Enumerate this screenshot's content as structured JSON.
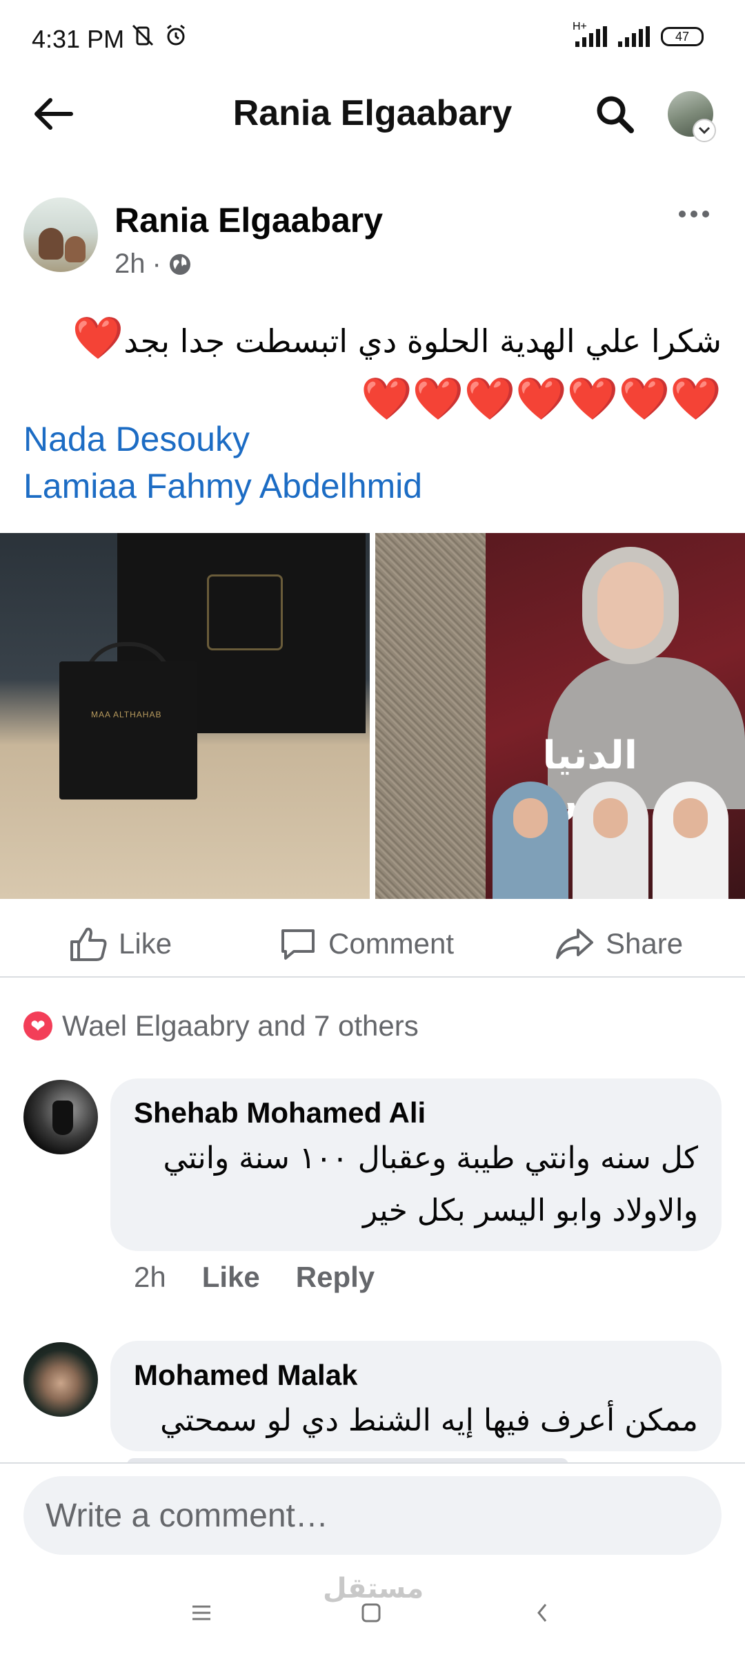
{
  "status_bar": {
    "time": "4:31 PM",
    "network": "H+",
    "battery": "47",
    "icons": [
      "mute-vibrate-icon",
      "alarm-icon",
      "signal-icon",
      "signal-icon",
      "battery-icon"
    ]
  },
  "header": {
    "title": "Rania Elgaabary",
    "icons": [
      "back-arrow-icon",
      "search-icon",
      "profile-avatar",
      "chevron-down-icon"
    ]
  },
  "post": {
    "author": "Rania Elgaabary",
    "time": "2h",
    "separator": "·",
    "privacy_icon": "globe-icon",
    "text_line1": "شكرا علي الهدية الحلوة دي اتبسطت جدا بجد",
    "hearts_line1": "❤️",
    "hearts_line2": "❤️❤️❤️❤️❤️❤️❤️",
    "tags": [
      "Nada Desouky",
      "Lamiaa Fahmy Abdelhmid"
    ],
    "photos": [
      {
        "alt": "gift bags on a desk",
        "bag_brand": "MAA ALTHAHAB"
      },
      {
        "alt": "women in front of TV banner",
        "banner_text": "الدنيا بخير"
      }
    ]
  },
  "actions": {
    "like": "Like",
    "comment": "Comment",
    "share": "Share"
  },
  "reactions": {
    "summary": "Wael Elgaabry and 7 others",
    "icon": "love-reaction-icon"
  },
  "comments": [
    {
      "author": "Shehab Mohamed Ali",
      "text_line1": "كل سنه وانتي طيبة وعقبال ١٠٠ سنة وانتي",
      "text_line2": "والاولاد وابو اليسر بكل خير",
      "time": "2h",
      "like": "Like",
      "reply": "Reply"
    },
    {
      "author": "Mohamed Malak",
      "text_line1": "ممكن أعرف فيها إيه الشنط دي لو سمحتي"
    }
  ],
  "composer": {
    "placeholder": "Write a comment…"
  },
  "nav_bar": {
    "watermark": "مستقل",
    "icons": [
      "menu-icon",
      "home-square-icon",
      "back-chevron-icon"
    ]
  },
  "colors": {
    "link": "#1c6cc4",
    "heart": "#e8112d",
    "secondary_text": "#65676b",
    "bubble": "#f0f2f5"
  }
}
